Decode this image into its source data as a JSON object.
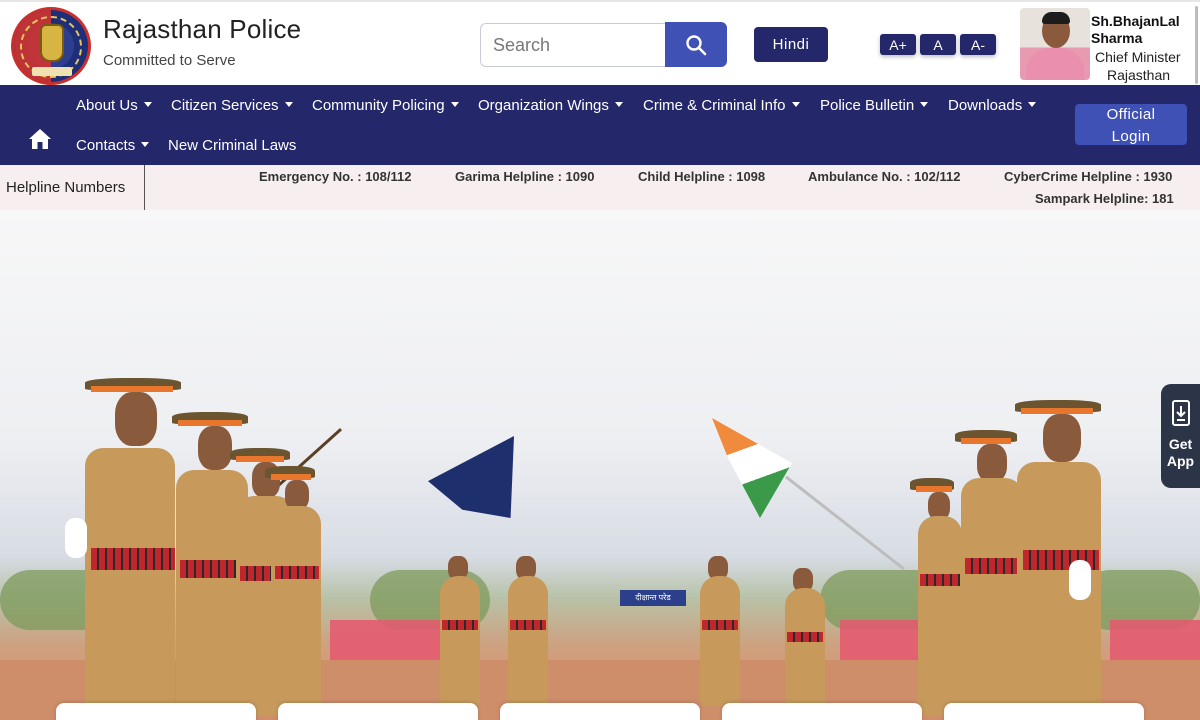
{
  "header": {
    "site_title": "Rajasthan Police",
    "tagline": "Committed to Serve",
    "search": {
      "placeholder": "Search",
      "value": ""
    },
    "search_icon": "search-icon",
    "language_button": "Hindi",
    "font_size_buttons": [
      "A+",
      "A",
      "A-"
    ],
    "chief_minister": {
      "name": "Sh.BhajanLal Sharma",
      "title": "Chief Minister",
      "state": "Rajasthan"
    }
  },
  "nav": {
    "home_icon": "home-icon",
    "row1": [
      {
        "label": "About Us",
        "dropdown": true
      },
      {
        "label": "Citizen Services",
        "dropdown": true
      },
      {
        "label": "Community Policing",
        "dropdown": true
      },
      {
        "label": "Organization Wings",
        "dropdown": true
      },
      {
        "label": "Crime & Criminal Info",
        "dropdown": true
      },
      {
        "label": "Police Bulletin",
        "dropdown": true
      },
      {
        "label": "Downloads",
        "dropdown": true
      }
    ],
    "row2": [
      {
        "label": "Contacts",
        "dropdown": true
      },
      {
        "label": "New Criminal Laws",
        "dropdown": false
      }
    ],
    "login_button": {
      "line1": "Official",
      "line2": "Login"
    }
  },
  "helpline": {
    "label": "Helpline Numbers",
    "items": [
      "Emergency No. : 108/112",
      "Garima Helpline : 1090",
      "Child Helpline : 1098",
      "Ambulance No. : 102/112",
      "CyberCrime Helpline : 1930",
      "Sampark Helpline: 181"
    ]
  },
  "hero": {
    "board_text": "दीक्षान्त परेड"
  },
  "get_app": {
    "label_line1": "Get",
    "label_line2": "App",
    "icon": "download-phone-icon"
  },
  "colors": {
    "nav_bg": "#25276b",
    "accent_blue": "#3f51b5",
    "helpline_bg": "#f7efef",
    "app_button_bg": "#2c3447"
  }
}
